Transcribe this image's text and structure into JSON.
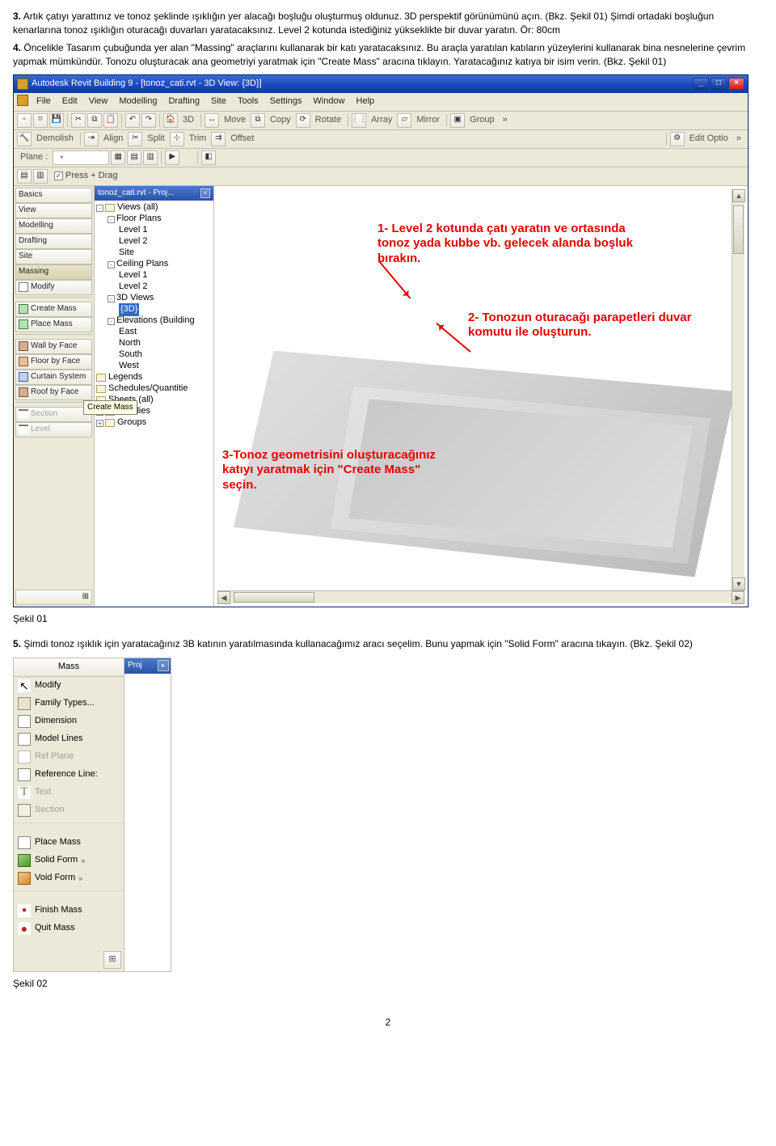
{
  "paragraphs": {
    "p3_num": "3.",
    "p3_text": "Artık çatıyı yarattınız ve tonoz şeklinde ışıklığın yer alacağı boşluğu oluşturmuş oldunuz. 3D perspektif görünümünü açın. (Bkz. Şekil 01) Şimdi ortadaki boşluğun kenarlarına tonoz ışıklığın oturacağı duvarları yaratacaksınız. Level 2 kotunda istediğiniz yükseklikte bir duvar yaratın. Ör: 80cm",
    "p4_num": "4.",
    "p4_text": "Öncelikle Tasarım çubuğunda yer alan \"Massing\" araçlarını kullanarak bir katı yaratacaksınız. Bu araçla yaratılan katıların yüzeylerini kullanarak bina nesnelerine çevrim yapmak mümkündür. Tonozu oluşturacak ana geometriyi yaratmak için \"Create Mass\" aracına tıklayın. Yaratacağınız katıya bir isim verin. (Bkz. Şekil 01)",
    "sekil01": "Şekil 01",
    "p5_num": "5.",
    "p5_text": "Şimdi tonoz ışıklık için yaratacağınız 3B katının yaratılmasında kullanacağımız aracı seçelim. Bunu yapmak için \"Solid Form\" aracına tıkayın. (Bkz. Şekil 02)",
    "sekil02": "Şekil 02",
    "pagenum": "2"
  },
  "app": {
    "title": "Autodesk Revit Building 9 - [tonoz_cati.rvt - 3D View: {3D}]",
    "menus": [
      "File",
      "Edit",
      "View",
      "Modelling",
      "Drafting",
      "Site",
      "Tools",
      "Settings",
      "Window",
      "Help"
    ],
    "toolbar1": {
      "undo": "↶",
      "redo": "↷",
      "view3d": "3D",
      "demolish": "Demolish",
      "align": "Align",
      "split": "Split",
      "trim": "Trim",
      "offset": "Offset"
    },
    "toolbar2": {
      "move": "Move",
      "copy": "Copy",
      "rotate": "Rotate",
      "array": "Array",
      "mirror": "Mirror",
      "group": "Group"
    },
    "toolbar3": {
      "plane": "Plane :",
      "planeopt": "",
      "editopt": "Edit Optio",
      "arrows": "»"
    },
    "toolbar4": {
      "pressdrag": "Press + Drag"
    },
    "designbar": {
      "basics": "Basics",
      "view": "View",
      "modelling": "Modelling",
      "drafting": "Drafting",
      "site": "Site",
      "massing": "Massing",
      "modify": "Modify",
      "createmass": "Create Mass",
      "placemass": "Place Mass",
      "wallbyface": "Wall by Face",
      "floorbyface": "Floor by Face",
      "curtainsystem": "Curtain System",
      "roofbyface": "Roof by Face"
    },
    "tooltip_createmass": "Create Mass",
    "browser": {
      "title": "tonoz_cati.rvt - Proj...",
      "views": "Views (all)",
      "floorplans": "Floor Plans",
      "l1": "Level 1",
      "l2": "Level 2",
      "site": "Site",
      "ceilplans": "Ceiling Plans",
      "cl1": "Level 1",
      "cl2": "Level 2",
      "threedviews": "3D Views",
      "threed": "{3D}",
      "elevations": "Elevations (Building",
      "east": "East",
      "north": "North",
      "south": "South",
      "west": "West",
      "legends": "Legends",
      "schedules": "Schedules/Quantitie",
      "sheets": "Sheets (all)",
      "families": "Families",
      "groups": "Groups"
    },
    "annotations": {
      "a1_l1": "1- Level 2 kotunda çatı yaratın ve ortasında",
      "a1_l2": "tonoz yada kubbe vb. gelecek alanda boşluk bırakın.",
      "a2_l1": "2- Tonozun oturacağı parapetleri duvar",
      "a2_l2": "komutu ile oluşturun.",
      "a3_l1": "3-Tonoz geometrisini oluşturacağınız",
      "a3_l2": "katıyı yaratmak için \"Create Mass\"",
      "a3_l3": "seçin."
    }
  },
  "masspanel": {
    "header": "Mass",
    "modify": "Modify",
    "famtypes": "Family Types...",
    "dimension": "Dimension",
    "modellines": "Model Lines",
    "refplane": "Ref Plane",
    "refline": "Reference Line:",
    "text": "Text",
    "section": "Section",
    "placemass": "Place Mass",
    "solidform": "Solid Form",
    "voidform": "Void Form",
    "finishmass": "Finish Mass",
    "quitmass": "Quit Mass",
    "sideheader": "Proj"
  }
}
